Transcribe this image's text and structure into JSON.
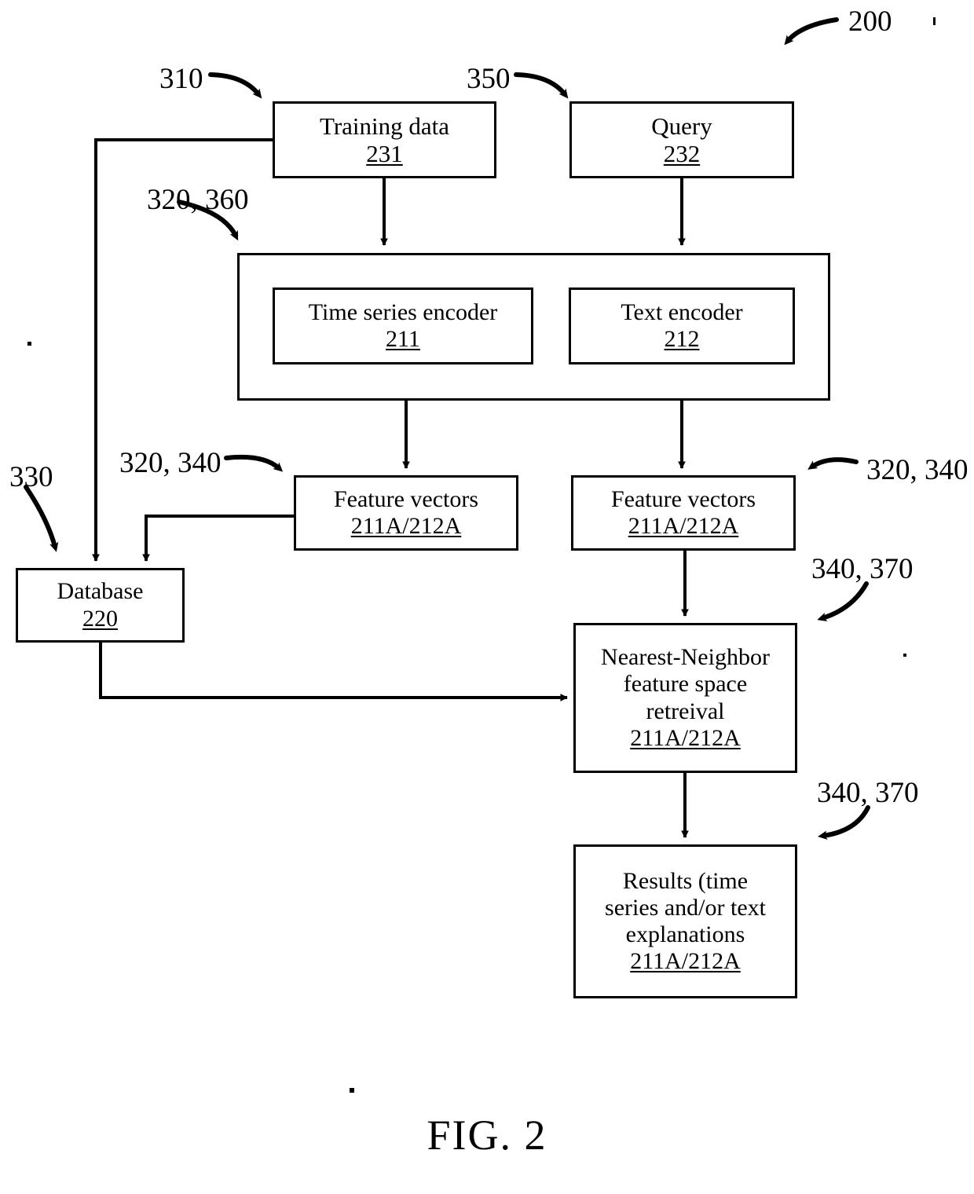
{
  "figure": {
    "caption": "FIG. 2",
    "system_ref": "200"
  },
  "boxes": {
    "training_data": {
      "title": "Training data",
      "ref": "231"
    },
    "query": {
      "title": "Query",
      "ref": "232"
    },
    "encoder_container": {
      "title": ""
    },
    "time_series_encoder": {
      "title": "Time series encoder",
      "ref": "211"
    },
    "text_encoder": {
      "title": "Text encoder",
      "ref": "212"
    },
    "feature_vectors_left": {
      "title": "Feature vectors",
      "ref": "211A/212A"
    },
    "feature_vectors_right": {
      "title": "Feature vectors",
      "ref": "211A/212A"
    },
    "database": {
      "title": "Database",
      "ref": "220"
    },
    "nearest_neighbor": {
      "line1": "Nearest-Neighbor",
      "line2": "feature space",
      "line3": "retreival",
      "ref": "211A/212A"
    },
    "results": {
      "line1": "Results (time",
      "line2": "series and/or text",
      "line3": "explanations",
      "ref": "211A/212A"
    }
  },
  "callouts": {
    "training_data_ref": "310",
    "query_ref": "350",
    "encoder_ref": "320, 360",
    "feature_vectors_left_ref": "320, 340",
    "feature_vectors_right_ref": "320, 340",
    "database_ref": "330",
    "nearest_neighbor_ref": "340, 370",
    "results_ref": "340, 370"
  },
  "colors": {
    "ink": "#000000",
    "paper": "#ffffff"
  }
}
